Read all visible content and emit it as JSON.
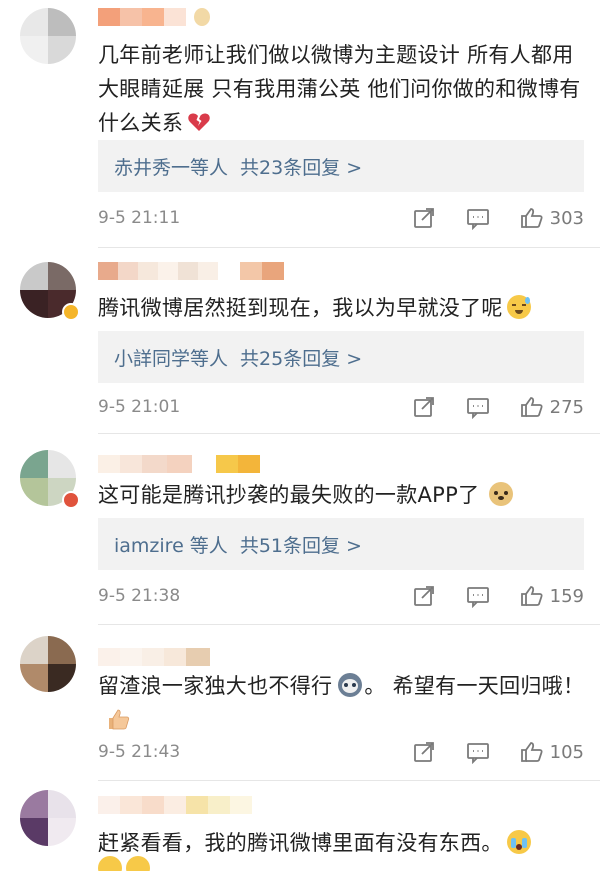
{
  "comments": [
    {
      "text": "几年前老师让我们做以微博为主题设计 所有人都用大眼睛延展 只有我用蒲公英 他们问你做的和微博有什么关系",
      "reply_user": "赤井秀一等人",
      "reply_count": "共23条回复 >",
      "time": "9-5 21:11",
      "likes": "303"
    },
    {
      "text": "腾讯微博居然挺到现在，我以为早就没了呢",
      "reply_user": "小詳同学等人",
      "reply_count": "共25条回复 >",
      "time": "9-5 21:01",
      "likes": "275"
    },
    {
      "text": "这可能是腾讯抄袭的最失败的一款APP了",
      "reply_user": "iamzire 等人",
      "reply_count": "共51条回复 >",
      "time": "9-5 21:38",
      "likes": "159"
    },
    {
      "text": "留渣浪一家独大也不得行",
      "text_after": "。 希望有一天回归哦！",
      "time": "9-5 21:43",
      "likes": "105"
    },
    {
      "text": "赶紧看看，我的腾讯微博里面有没有东西。"
    }
  ],
  "colors": {
    "reply_link": "#4e6e8e",
    "meta_gray": "#8a8a8a",
    "reply_bg": "#f2f2f2"
  },
  "icons": [
    "repost-icon",
    "comment-icon",
    "like-icon",
    "broken-heart-emoji",
    "sweat-emoji",
    "doge-emoji",
    "husky-emoji",
    "thumbs-up-emoji",
    "crying-emoji"
  ]
}
